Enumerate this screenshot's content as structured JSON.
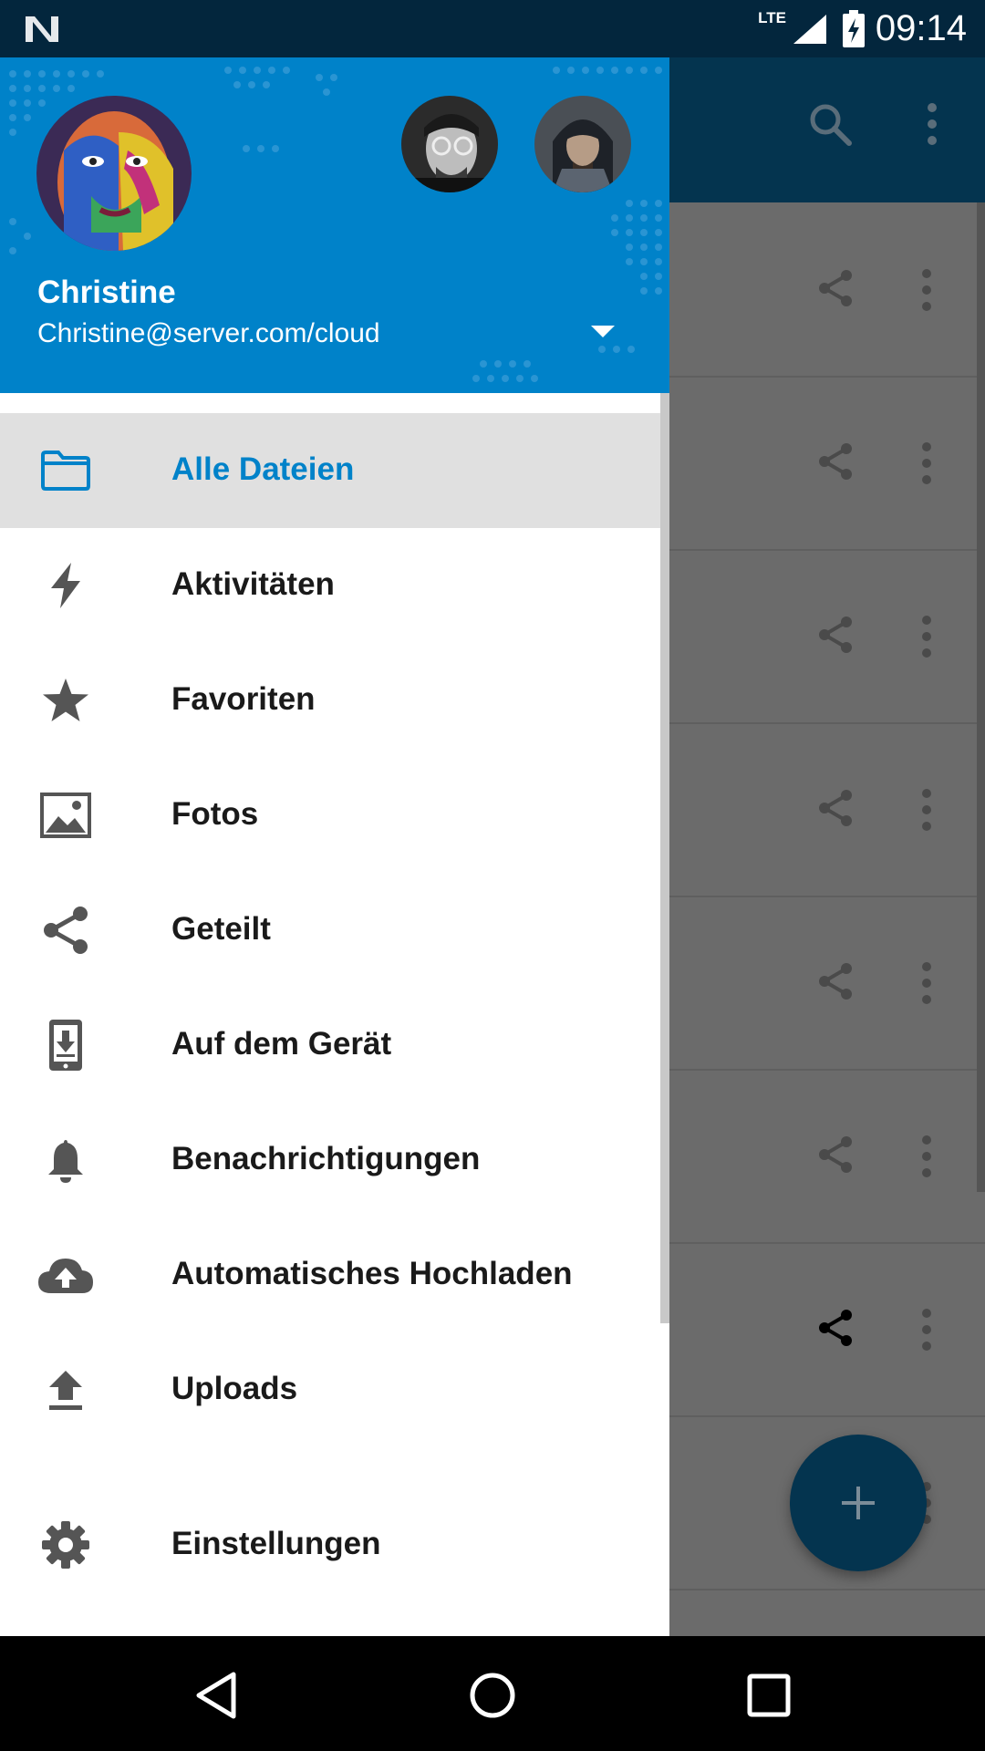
{
  "status_bar": {
    "time": "09:14",
    "network": "LTE"
  },
  "account": {
    "name": "Christine",
    "server": "Christine@server.com/cloud"
  },
  "menu": [
    {
      "label": "Alle Dateien",
      "icon": "folder-icon",
      "active": true
    },
    {
      "label": "Aktivitäten",
      "icon": "lightning-icon"
    },
    {
      "label": "Favoriten",
      "icon": "star-icon"
    },
    {
      "label": "Fotos",
      "icon": "image-icon"
    },
    {
      "label": "Geteilt",
      "icon": "share-icon"
    },
    {
      "label": "Auf dem Gerät",
      "icon": "device-icon"
    },
    {
      "label": "Benachrichtigungen",
      "icon": "bell-icon"
    },
    {
      "label": "Automatisches Hochladen",
      "icon": "cloud-upload-icon"
    },
    {
      "label": "Uploads",
      "icon": "upload-icon"
    },
    {
      "label": "Einstellungen",
      "icon": "gear-icon"
    }
  ],
  "colors": {
    "brand": "#0082c9",
    "toolbar_dimmed": "#04344f",
    "status_bar": "#03263d"
  }
}
